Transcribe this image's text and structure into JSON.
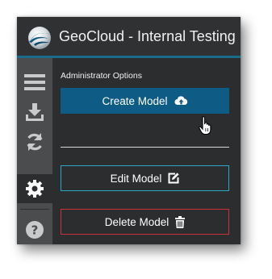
{
  "window": {
    "title": "GeoCloud - Internal Testing"
  },
  "sidebar": {
    "items": [
      {
        "icon": "menu-icon"
      },
      {
        "icon": "download-icon"
      },
      {
        "icon": "refresh-icon"
      },
      {
        "icon": "gear-icon",
        "active": true
      },
      {
        "icon": "help-icon"
      }
    ]
  },
  "main": {
    "section_label": "Administrator Options",
    "create_label": "Create Model",
    "edit_label": "Edit Model",
    "delete_label": "Delete Model"
  },
  "colors": {
    "titlebar_accent": "#1a6a8a",
    "create_bg": "#0e5b85",
    "edit_border": "#2aa6c8",
    "delete_border": "#c8323a"
  }
}
